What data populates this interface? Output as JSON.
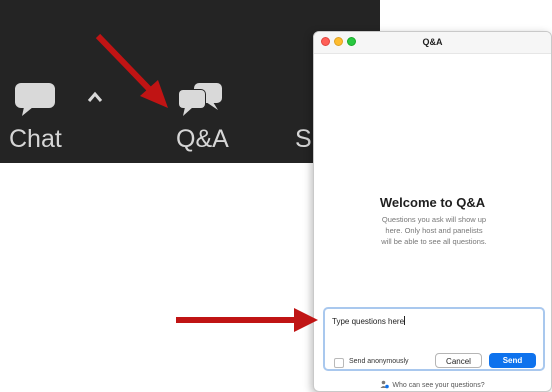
{
  "toolbar": {
    "chat_label": "Chat",
    "qa_label": "Q&A",
    "partial_label": "S"
  },
  "qa_window": {
    "title": "Q&A",
    "welcome_title": "Welcome to Q&A",
    "welcome_desc_line1": "Questions you ask will show up",
    "welcome_desc_line2": "here. Only host and panelists",
    "welcome_desc_line3": "will be able to see all questions.",
    "input_value": "Type questions here",
    "send_anonymously_label": "Send anonymously",
    "send_anonymously_checked": false,
    "cancel_label": "Cancel",
    "send_label": "Send",
    "footer_link": "Who can see your questions?"
  },
  "annotations": {
    "arrow_color": "#c01414"
  },
  "colors": {
    "toolbar_bg": "#242424",
    "send_button": "#0e72ed",
    "input_focus_border": "#a9c8ee"
  }
}
